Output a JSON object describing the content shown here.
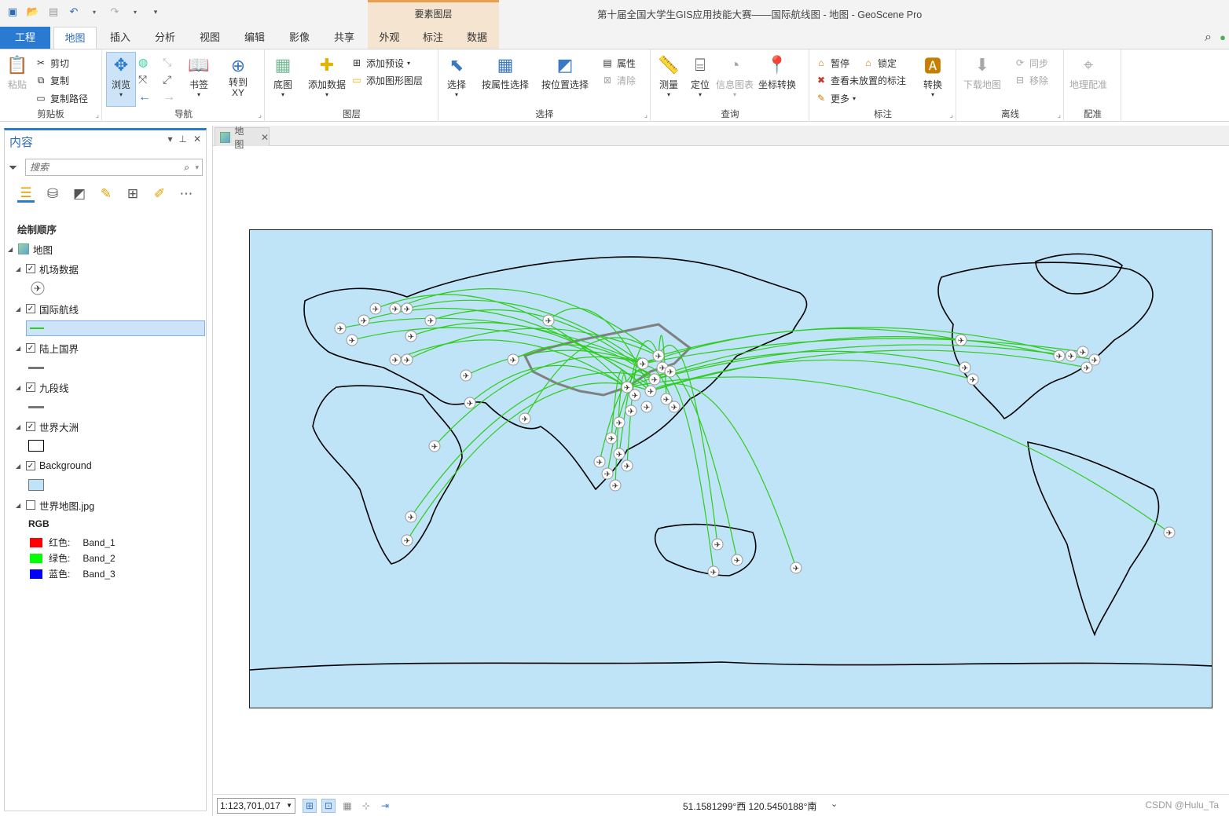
{
  "window": {
    "title": "第十届全国大学生GIS应用技能大赛——国际航线图 - 地图 - GeoScene Pro",
    "context_tab_group": "要素图层"
  },
  "tabs": {
    "project": "工程",
    "map": "地图",
    "insert": "插入",
    "analysis": "分析",
    "view": "视图",
    "edit": "编辑",
    "imagery": "影像",
    "share": "共享",
    "appearance": "外观",
    "labeling": "标注",
    "data": "数据"
  },
  "ribbon": {
    "clipboard": {
      "label": "剪贴板",
      "paste": "粘贴",
      "cut": "剪切",
      "copy": "复制",
      "copy_path": "复制路径"
    },
    "navigate": {
      "label": "导航",
      "explore": "浏览",
      "bookmarks": "书签",
      "goto_xy": "转到\nXY"
    },
    "layer": {
      "label": "图层",
      "basemap": "底图",
      "add_data": "添加数据",
      "add_preset": "添加预设",
      "add_graphics_layer": "添加图形图层"
    },
    "selection": {
      "label": "选择",
      "select": "选择",
      "select_by_attr": "按属性选择",
      "select_by_loc": "按位置选择",
      "attributes": "属性",
      "clear": "清除"
    },
    "inquiry": {
      "label": "查询",
      "measure": "测量",
      "locate": "定位",
      "infographics": "信息图表",
      "coord_conversion": "坐标转换"
    },
    "labeling": {
      "label": "标注",
      "pause": "暂停",
      "lock": "锁定",
      "view_unplaced": "查看未放置的标注",
      "more": "更多",
      "convert": "转换"
    },
    "offline": {
      "label": "离线",
      "download_map": "下载地图",
      "sync": "同步",
      "remove": "移除"
    },
    "georeference": {
      "label": "配准",
      "georeference": "地理配准"
    }
  },
  "contents": {
    "title": "内容",
    "search_placeholder": "搜索",
    "drawing_order": "绘制顺序",
    "map": "地图",
    "layers": [
      {
        "name": "机场数据",
        "checked": true
      },
      {
        "name": "国际航线",
        "checked": true
      },
      {
        "name": "陆上国界",
        "checked": true
      },
      {
        "name": "九段线",
        "checked": true
      },
      {
        "name": "世界大洲",
        "checked": true
      },
      {
        "name": "Background",
        "checked": true
      },
      {
        "name": "世界地图.jpg",
        "checked": false
      }
    ],
    "rgb": {
      "label": "RGB",
      "bands": [
        {
          "channel": "红色:",
          "band": "Band_1",
          "color": "#ff0000"
        },
        {
          "channel": "绿色:",
          "band": "Band_2",
          "color": "#00ff00"
        },
        {
          "channel": "蓝色:",
          "band": "Band_3",
          "color": "#0000ff"
        }
      ]
    }
  },
  "map_view": {
    "tab": "地图",
    "scale": "1:123,701,017",
    "coordinates": "51.1581299°西 120.5450188°南",
    "watermark": "CSDN @Hulu_Ta",
    "colors": {
      "ocean": "#bfe3f7",
      "routes": "#2ecc1a",
      "land_outline": "#000000",
      "china_border": "#808080"
    }
  }
}
